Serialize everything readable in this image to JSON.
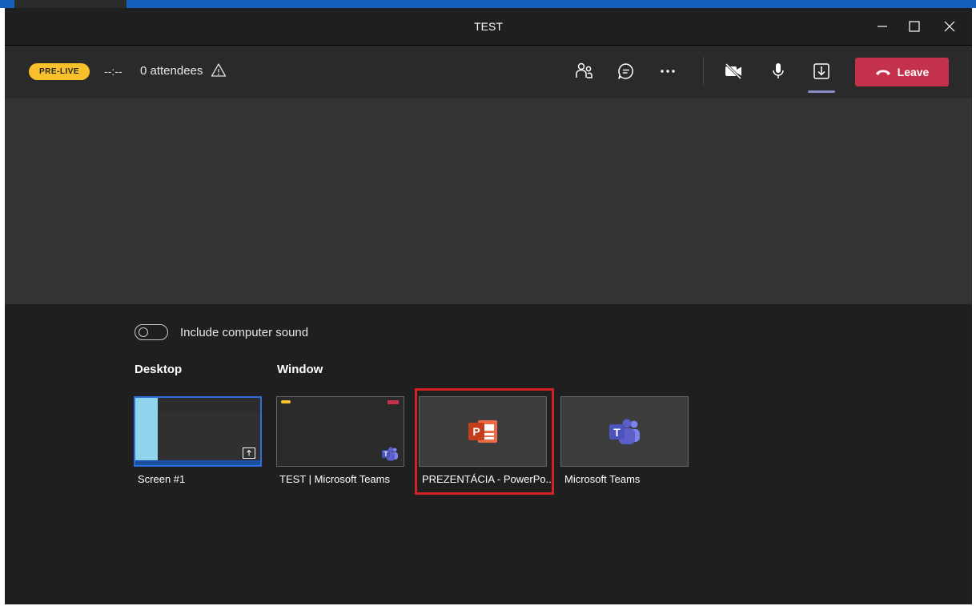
{
  "window": {
    "title": "TEST"
  },
  "toolbar": {
    "status_badge": "PRE-LIVE",
    "timer": "--:--",
    "attendees": "0 attendees",
    "leave_label": "Leave"
  },
  "share_tray": {
    "include_sound_label": "Include computer sound",
    "include_sound_on": false,
    "desktop_heading": "Desktop",
    "window_heading": "Window",
    "tiles": [
      {
        "label": "Screen #1"
      },
      {
        "label": "TEST | Microsoft Teams"
      },
      {
        "label": "PREZENTÁCIA - PowerPo..."
      },
      {
        "label": "Microsoft Teams"
      }
    ]
  },
  "icons": {
    "window": [
      "minimize-icon",
      "maximize-icon",
      "close-icon"
    ],
    "toolbar": [
      "warning-icon",
      "people-icon",
      "chat-icon",
      "more-options-icon",
      "camera-off-icon",
      "microphone-icon",
      "share-tray-icon",
      "hang-up-icon"
    ],
    "tiles": [
      "share-screen-icon",
      "teams-app-icon",
      "powerpoint-app-icon"
    ]
  },
  "colors": {
    "accent_badge": "#f8c12c",
    "leave_button": "#c4314b",
    "highlight_box": "#d32128",
    "active_underline": "#8b8cc7",
    "teams_purple": "#5b5fc7",
    "powerpoint_orange": "#d04423"
  }
}
